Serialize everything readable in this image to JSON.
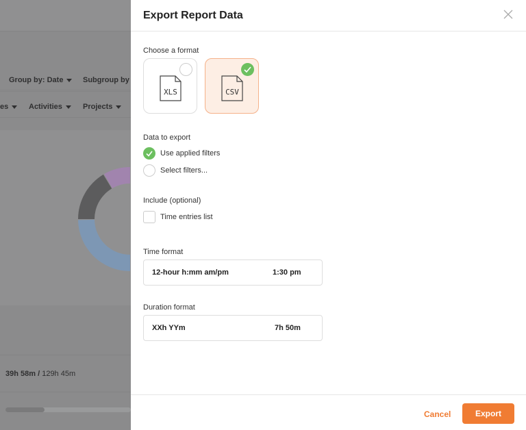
{
  "background": {
    "group_by": "Group by: Date",
    "subgroup_by": "Subgroup by",
    "filters": [
      "es",
      "Activities",
      "Projects"
    ],
    "total_worked": "39h 58m /",
    "total_available": "129h 45m",
    "progress_percent": 31,
    "donut_colors": [
      "#b07cc6",
      "#555555",
      "#6e9ed1"
    ]
  },
  "dialog": {
    "title": "Export Report Data",
    "choose_format_label": "Choose a format",
    "formats": [
      {
        "label": "XLS",
        "selected": false
      },
      {
        "label": "CSV",
        "selected": true
      }
    ],
    "data_to_export_label": "Data to export",
    "data_options": [
      {
        "label": "Use applied filters",
        "selected": true
      },
      {
        "label": "Select filters...",
        "selected": false
      }
    ],
    "include_label": "Include (optional)",
    "include_options": [
      {
        "label": "Time entries list",
        "checked": false
      }
    ],
    "time_format_label": "Time format",
    "time_format": {
      "value": "12-hour h:mm am/pm",
      "example": "1:30 pm"
    },
    "duration_format_label": "Duration format",
    "duration_format": {
      "value": "XXh YYm",
      "example": "7h 50m"
    },
    "cancel_label": "Cancel",
    "export_label": "Export"
  },
  "colors": {
    "accent": "#f07c33",
    "success": "#6cbf5f"
  }
}
